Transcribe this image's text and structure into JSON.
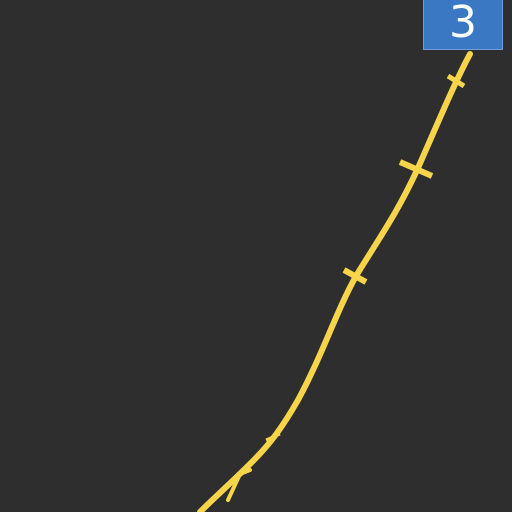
{
  "map": {
    "background_color": "#2e2e2e",
    "route": {
      "color": "#f7d54a",
      "style": "solid-line-with-cross-ticks"
    }
  },
  "route_badge": {
    "label": "3",
    "color": "#3a78c3"
  }
}
